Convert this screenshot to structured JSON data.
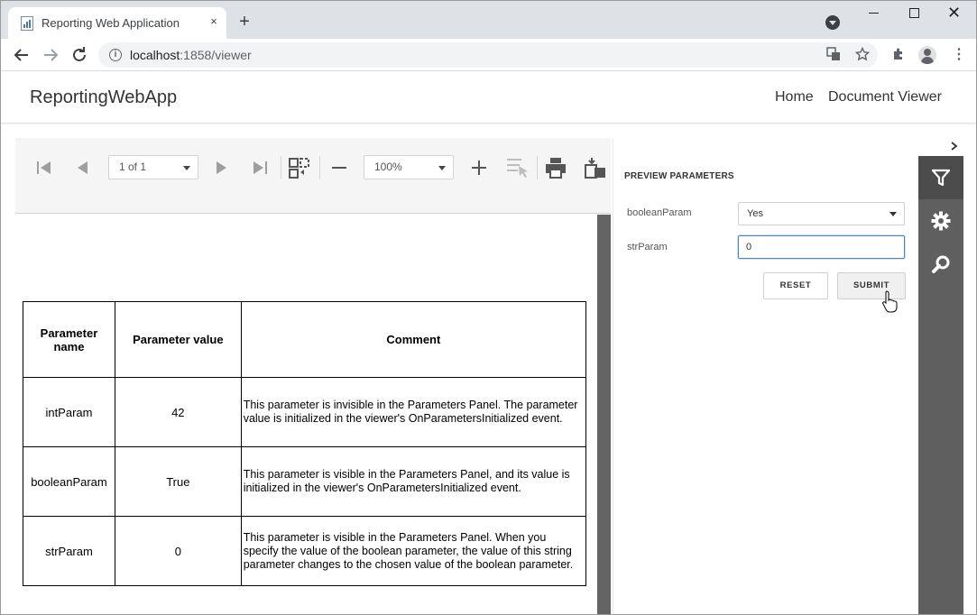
{
  "browser": {
    "tab_title": "Reporting Web Application",
    "tab_close": "×",
    "new_tab": "+",
    "url_host": "localhost",
    "url_path": ":1858/viewer",
    "window_close": "✕",
    "icons": [
      "back-icon",
      "forward-icon",
      "reload-icon",
      "info-icon",
      "translate-icon",
      "star-icon",
      "extensions-icon",
      "profile-icon",
      "menu-icon"
    ]
  },
  "app": {
    "brand": "ReportingWebApp",
    "nav": [
      {
        "label": "Home"
      },
      {
        "label": "Document Viewer"
      }
    ]
  },
  "toolbar": {
    "page_selector": "1 of 1",
    "zoom": "100%"
  },
  "report": {
    "headers": [
      "Parameter name",
      "Parameter value",
      "Comment"
    ],
    "rows": [
      {
        "name": "intParam",
        "value": "42",
        "comment": "This parameter is invisible in the Parameters Panel. The parameter value is initialized in the viewer's OnParametersInitialized event."
      },
      {
        "name": "booleanParam",
        "value": "True",
        "comment": "This parameter is visible in the Parameters Panel, and its value is initialized in the viewer's OnParametersInitialized event."
      },
      {
        "name": "strParam",
        "value": "0",
        "comment": "This parameter is visible in the Parameters Panel. When you specify the value of the boolean parameter, the value of this string parameter changes to the chosen value of the boolean parameter."
      }
    ]
  },
  "panel": {
    "heading": "PREVIEW PARAMETERS",
    "boolean_label": "booleanParam",
    "boolean_value": "Yes",
    "str_label": "strParam",
    "str_value": "0",
    "reset_label": "RESET",
    "submit_label": "SUBMIT",
    "collapse_glyph": ">"
  },
  "colors": {
    "sidebar": "#5f5f5f",
    "sidebar_active": "#4c4c4c",
    "input_focus": "#4a87c7",
    "tab_strip": "#dee1e6"
  }
}
